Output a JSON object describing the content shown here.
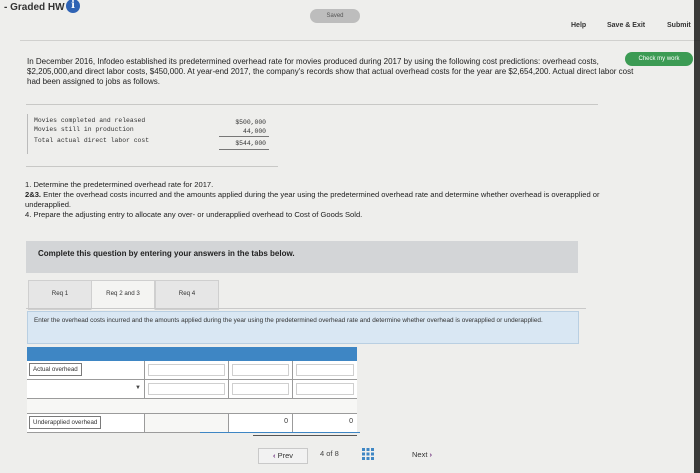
{
  "header": {
    "title": "- Graded HW",
    "saved_badge": "Saved",
    "help": "Help",
    "save_exit": "Save & Exit",
    "submit": "Submit",
    "check_my_work": "Check my work"
  },
  "problem": {
    "text": "In December 2016, Infodeo established its predetermined overhead rate for movies produced during 2017 by using the following cost predictions: overhead costs, $2,205,000,and direct labor costs, $450,000. At year-end 2017, the company's records show that actual overhead costs for the year are $2,654,200. Actual direct labor cost had been assigned to jobs as follows."
  },
  "labor_table": {
    "rows": [
      {
        "label": "Movies completed and released",
        "value": "$500,000"
      },
      {
        "label": "Movies still in production",
        "value": "44,000"
      },
      {
        "label": "Total actual direct labor cost",
        "value": "$544,000"
      }
    ]
  },
  "requirements": {
    "r1": "1. Determine the predetermined overhead rate for 2017.",
    "r2_prefix": "2&3.",
    "r2": " Enter the overhead costs incurred and the amounts applied during the year using the predetermined overhead rate and determine whether overhead is overapplied or underapplied.",
    "r4": "4. Prepare the adjusting entry to allocate any over- or underapplied overhead to Cost of Goods Sold."
  },
  "banner": "Complete this question by entering your answers in the tabs below.",
  "tabs": [
    {
      "label": "Req 1"
    },
    {
      "label": "Req 2 and 3"
    },
    {
      "label": "Req 4"
    }
  ],
  "instruction": "Enter the overhead costs incurred and the amounts applied during the year using the predetermined overhead rate and determine whether overhead is overapplied or underapplied.",
  "answer_table": {
    "row1_label": "Actual overhead",
    "row3_label": "Underapplied overhead",
    "row3_value_a": "0",
    "row3_value_b": "0"
  },
  "pager": {
    "prev": "Prev",
    "current": "4",
    "of": "of",
    "total": "8",
    "next": "Next"
  }
}
